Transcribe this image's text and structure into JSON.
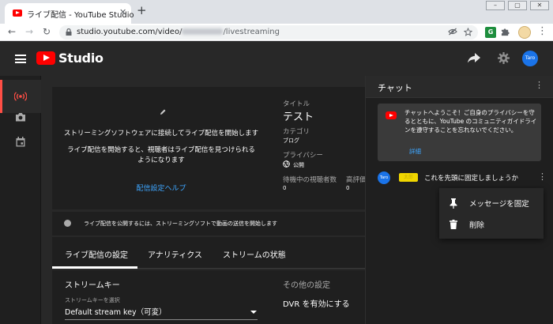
{
  "browser": {
    "tab_title": "ライブ配信 - YouTube Studio",
    "tab_close": "✕",
    "new_tab": "+",
    "url_prefix": "studio.youtube.com/video/",
    "url_suffix": "/livestreaming",
    "ext_badge": "G",
    "nav_back": "←",
    "nav_forward": "→",
    "nav_reload": "↻",
    "menu": "⋮"
  },
  "studio": {
    "brand": "Studio",
    "avatar_label": "Taro"
  },
  "preview": {
    "line1": "ストリーミングソフトウェアに接続してライブ配信を開始します",
    "line2": "ライブ配信を開始すると、視聴者はライブ配信を見つけられるようになります",
    "help_link": "配信設定ヘルプ"
  },
  "details": {
    "title_label": "タイトル",
    "title_value": "テスト",
    "category_label": "カテゴリ",
    "category_value": "ブログ",
    "privacy_label": "プライバシー",
    "privacy_value": "公開",
    "waiting_label": "待機中の視聴者数",
    "waiting_value": "0",
    "rating_label": "高評価",
    "rating_value": "0"
  },
  "notice": {
    "text": "ライブ配信を公開するには、ストリーミングソフトで動画の送信を開始します"
  },
  "settings_tabs": [
    {
      "label": "ライブ配信の設定"
    },
    {
      "label": "アナリティクス"
    },
    {
      "label": "ストリームの状態"
    }
  ],
  "stream_key": {
    "title": "ストリームキー",
    "select_label": "ストリームキーを選択",
    "select_value": "Default stream key（可変）"
  },
  "other_settings": {
    "title": "その他の設定",
    "dvr_label": "DVR を有効にする"
  },
  "chat": {
    "title": "チャット",
    "more": "⋮",
    "welcome_text": "チャットへようこそ！ご自身のプライバシーを守るとともに、YouTube のコミュニティガイドラインを遵守することを忘れないでください。",
    "welcome_link": "詳細",
    "message": {
      "avatar": "Taro",
      "author": "太郎",
      "text": "これを先頭に固定しましょうか"
    },
    "menu": {
      "pin_label": "メッセージを固定",
      "delete_label": "削除"
    }
  },
  "colors": {
    "accent_red": "#ff0000",
    "link_blue": "#3ea6ff",
    "live_indicator": "#ff4e45"
  }
}
